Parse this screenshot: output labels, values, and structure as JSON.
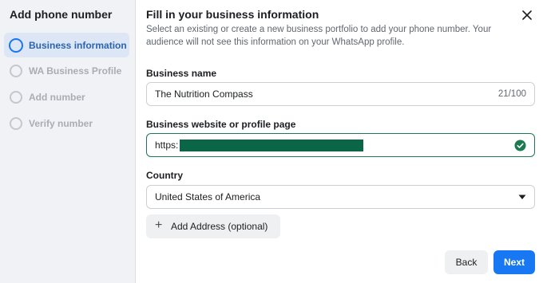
{
  "sidebar": {
    "title": "Add phone number",
    "steps": [
      {
        "label": "Business information",
        "active": true
      },
      {
        "label": "WA Business Profile",
        "active": false
      },
      {
        "label": "Add number",
        "active": false
      },
      {
        "label": "Verify number",
        "active": false
      }
    ]
  },
  "main": {
    "title": "Fill in your business information",
    "subtitle": "Select an existing or create a new business portfolio to add your phone number. Your audience will not see this information on your WhatsApp profile.",
    "business_name": {
      "label": "Business name",
      "value": "The Nutrition Compass",
      "counter": "21/100"
    },
    "website": {
      "label": "Business website or profile page",
      "value": "https:"
    },
    "country": {
      "label": "Country",
      "value": "United States of America"
    },
    "add_address_label": "Add Address (optional)",
    "back_label": "Back",
    "next_label": "Next"
  },
  "icons": {
    "close": "close-icon",
    "check": "check-circle-icon",
    "caret": "caret-down-icon",
    "plus": "plus-icon"
  },
  "colors": {
    "primary": "#1877f2",
    "success": "#1b7a51",
    "redaction": "#0a6647"
  }
}
